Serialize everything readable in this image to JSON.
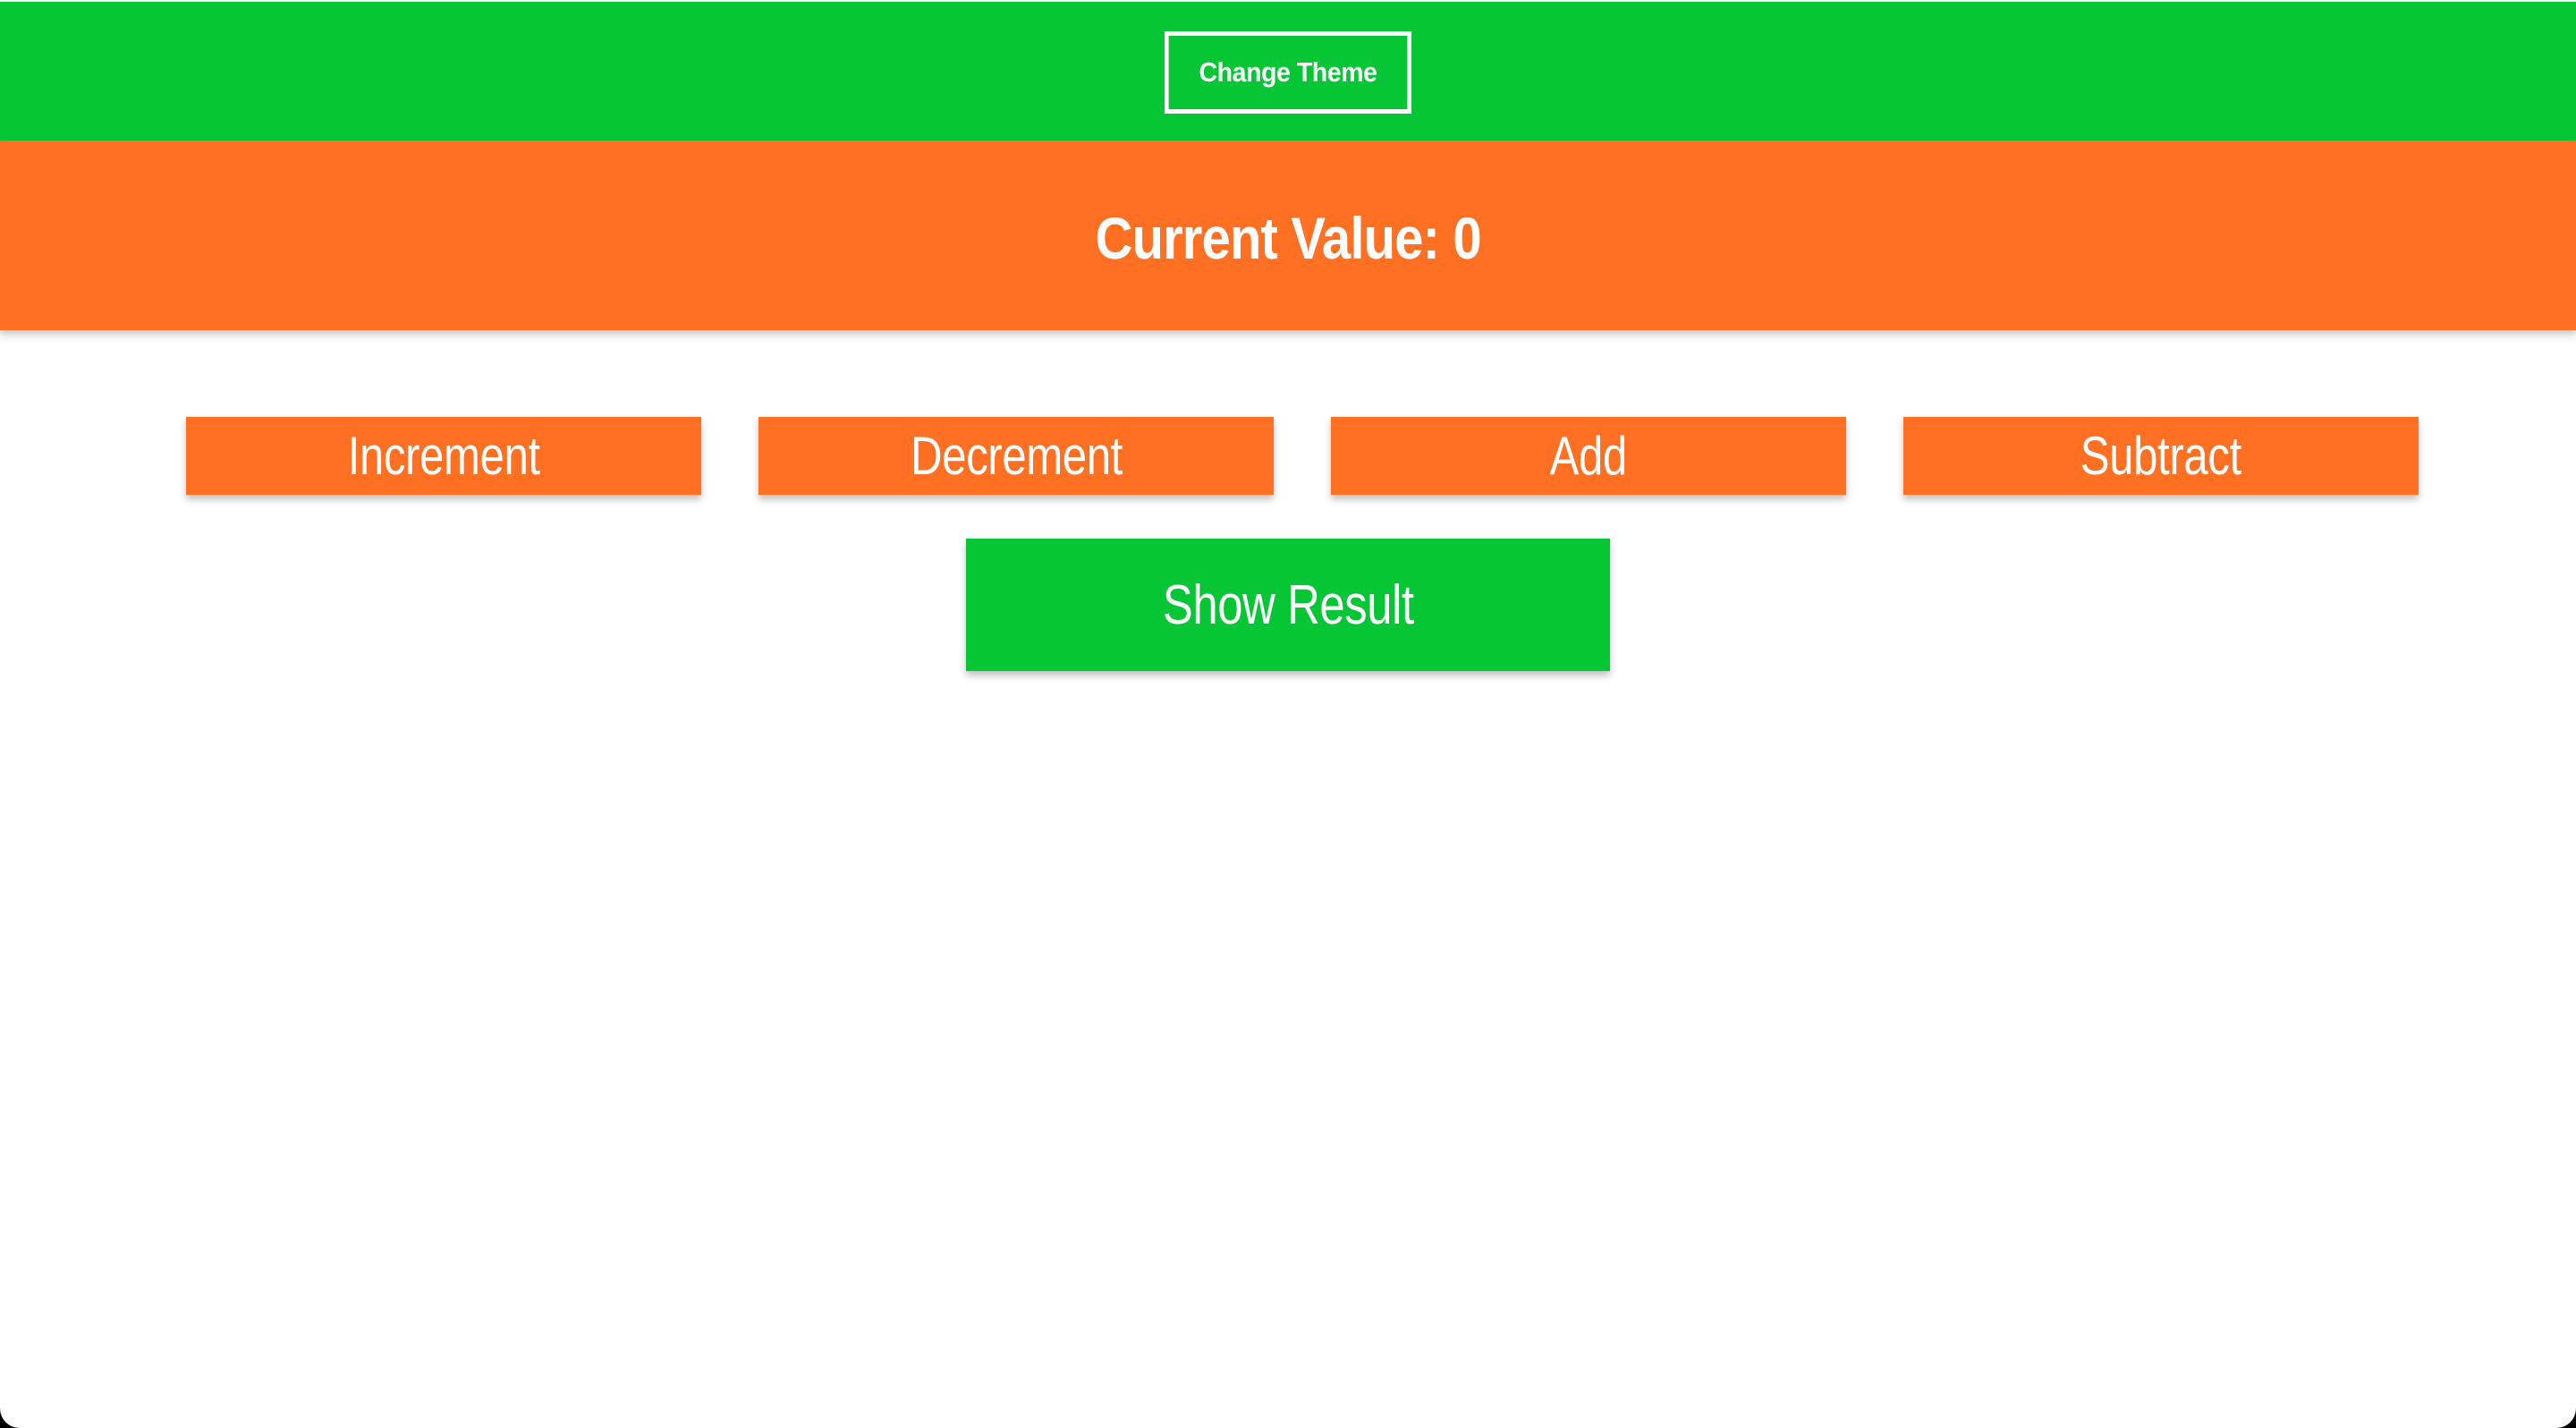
{
  "header": {
    "change_theme_label": "Change Theme"
  },
  "display": {
    "label": "Current Value:",
    "value": "0",
    "text": "Current Value: 0"
  },
  "operations": [
    {
      "label": "Increment"
    },
    {
      "label": "Decrement"
    },
    {
      "label": "Add"
    },
    {
      "label": "Subtract"
    }
  ],
  "result": {
    "label": "Show Result"
  },
  "colors": {
    "primary_green": "#07c636",
    "accent_orange": "#ff7022",
    "text": "#ffffff",
    "background": "#ffffff"
  }
}
